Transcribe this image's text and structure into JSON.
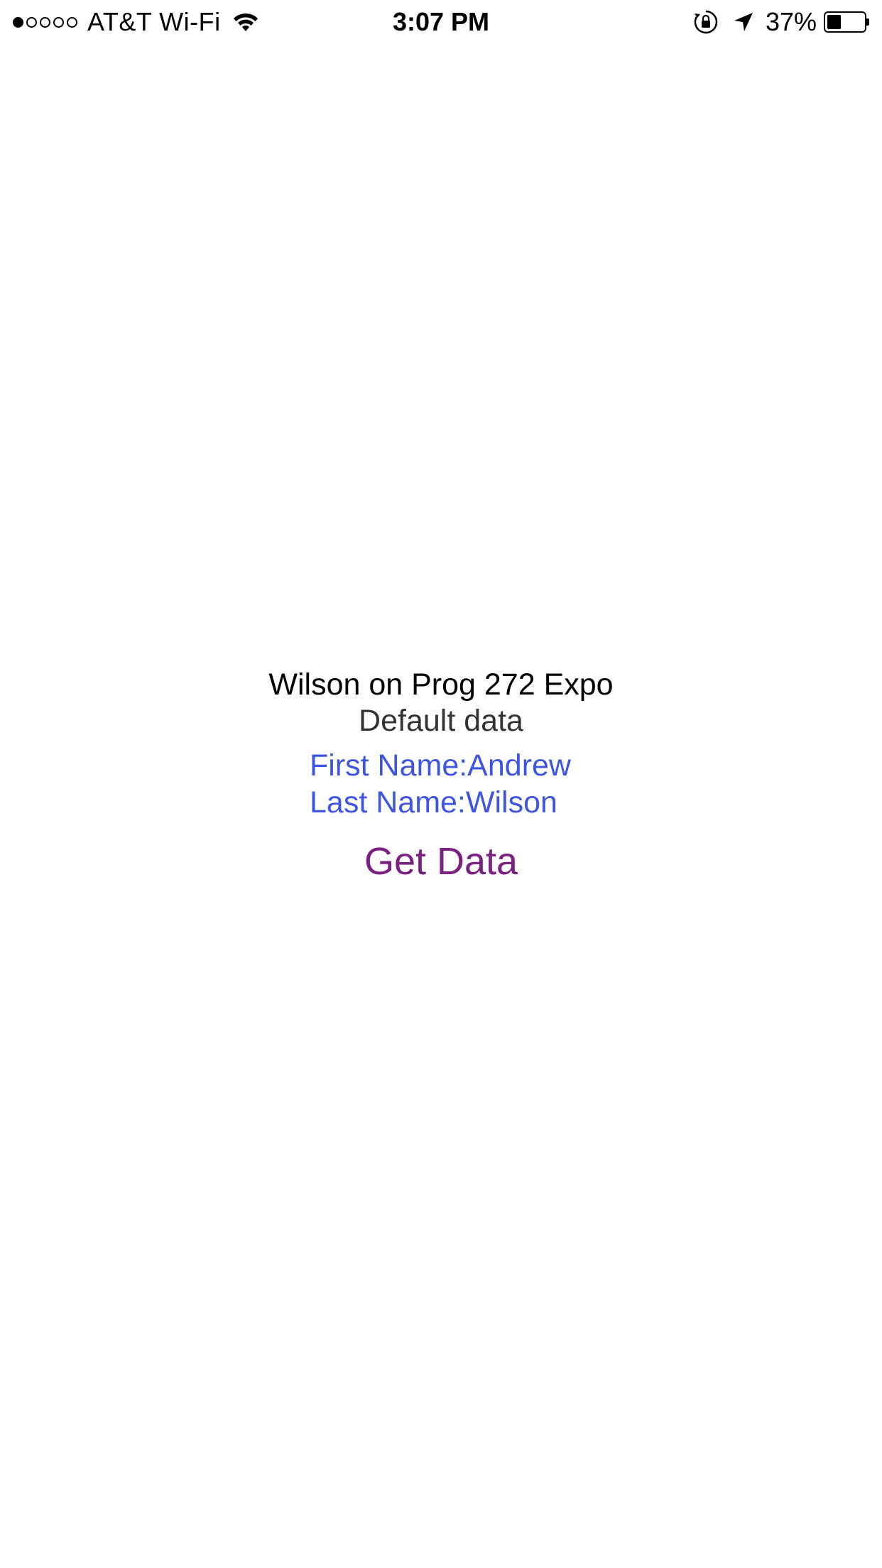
{
  "status_bar": {
    "signal_strength": 1,
    "signal_max": 5,
    "carrier": "AT&T Wi-Fi",
    "wifi_icon": "wifi-icon",
    "time": "3:07 PM",
    "lock_icon": "rotation-lock-icon",
    "location_icon": "location-arrow-icon",
    "battery_percent": "37%",
    "battery_level": 0.37,
    "battery_icon": "battery-icon"
  },
  "main": {
    "title": "Wilson on Prog 272 Expo",
    "subtitle": "Default data",
    "first_name_line": "First Name:Andrew",
    "last_name_line": "Last Name:Wilson",
    "get_data_label": "Get Data"
  },
  "colors": {
    "background": "#ffffff",
    "title_text": "#000000",
    "subtitle_text": "#333333",
    "info_text": "#3d55e0",
    "button_text": "#7b2182"
  }
}
